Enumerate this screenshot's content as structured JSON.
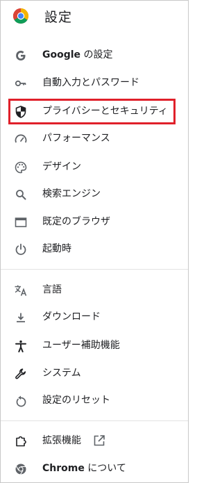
{
  "header": {
    "title": "設定",
    "logo_icon": "chrome-logo"
  },
  "menu": {
    "google": {
      "label_bold": "Google",
      "label_rest": " の設定",
      "icon": "google-g-icon"
    },
    "autofill": {
      "label": "自動入力とパスワード",
      "icon": "key-icon"
    },
    "privacy": {
      "label": "プライバシーとセキュリティ",
      "icon": "shield-icon",
      "highlighted": true
    },
    "performance": {
      "label": "パフォーマンス",
      "icon": "speedometer-icon"
    },
    "appearance": {
      "label": "デザイン",
      "icon": "palette-icon"
    },
    "search_engine": {
      "label": "検索エンジン",
      "icon": "search-icon"
    },
    "default_browser": {
      "label": "既定のブラウザ",
      "icon": "browser-window-icon"
    },
    "on_startup": {
      "label": "起動時",
      "icon": "power-icon"
    },
    "languages": {
      "label": "言語",
      "icon": "translate-icon"
    },
    "downloads": {
      "label": "ダウンロード",
      "icon": "download-icon"
    },
    "accessibility": {
      "label": "ユーザー補助機能",
      "icon": "accessibility-icon"
    },
    "system": {
      "label": "システム",
      "icon": "wrench-icon"
    },
    "reset": {
      "label": "設定のリセット",
      "icon": "reset-icon"
    },
    "extensions": {
      "label": "拡張機能",
      "icon": "puzzle-icon",
      "external_icon": "open-in-new-icon"
    },
    "about": {
      "label_bold": "Chrome",
      "label_rest": " について",
      "icon": "chrome-mono-icon"
    }
  },
  "colors": {
    "highlight_border": "#e0202a",
    "icon": "#5f6368",
    "text": "#202124"
  }
}
